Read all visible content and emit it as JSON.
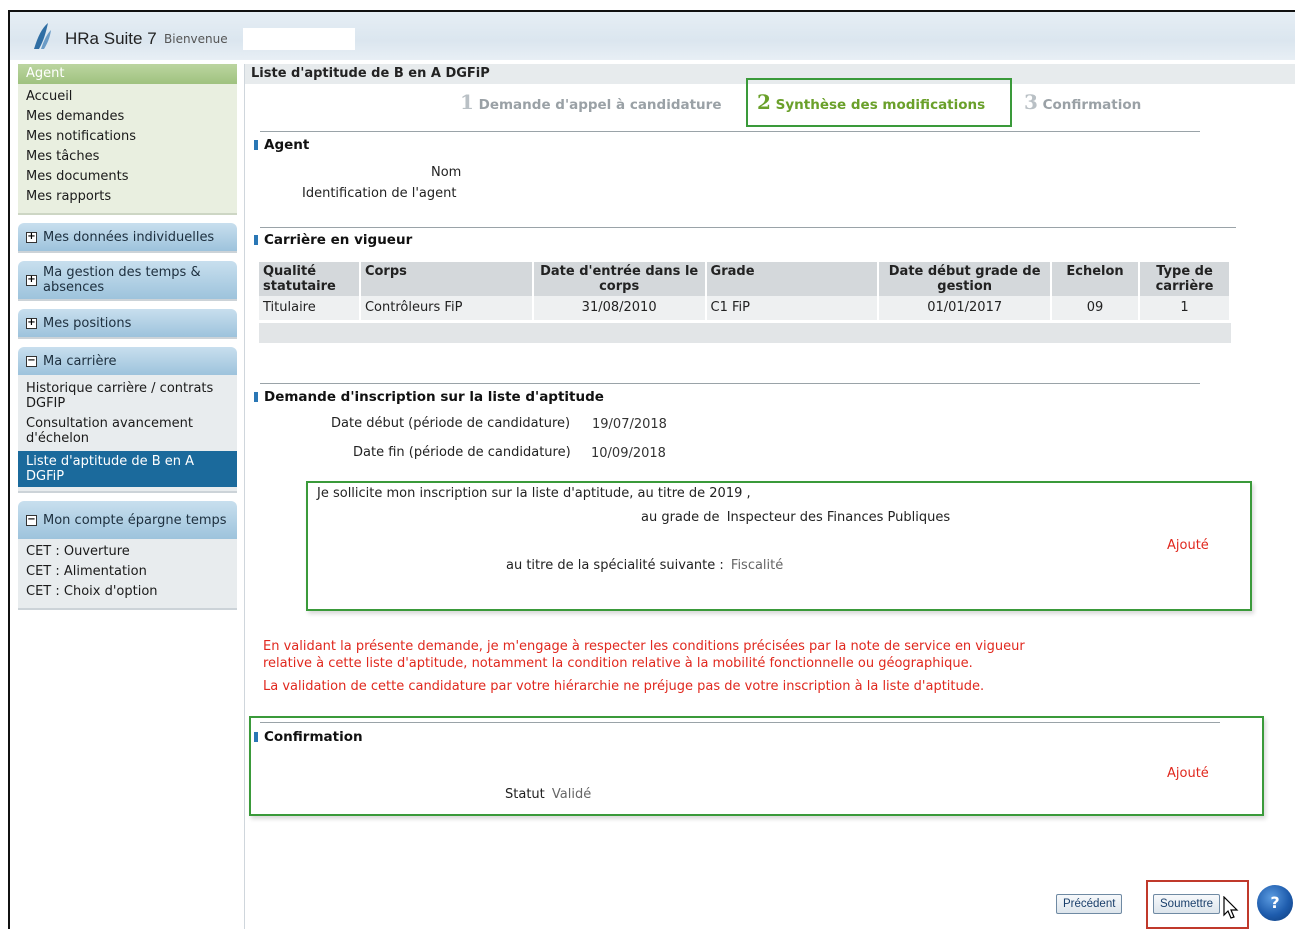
{
  "header": {
    "app_name": "HRa Suite 7",
    "welcome": "Bienvenue"
  },
  "sidebar": {
    "agent_panel": {
      "title": "Agent",
      "items": [
        "Accueil",
        "Mes demandes",
        "Mes notifications",
        "Mes tâches",
        "Mes documents",
        "Mes rapports"
      ]
    },
    "donnees": {
      "title": "Mes données individuelles",
      "toggle": "+"
    },
    "temps": {
      "title": "Ma gestion des temps & absences",
      "toggle": "+"
    },
    "positions": {
      "title": "Mes positions",
      "toggle": "+"
    },
    "carriere": {
      "title": "Ma carrière",
      "toggle": "−",
      "items": [
        "Historique carrière / contrats DGFIP",
        "Consultation avancement d'échelon",
        "Liste d'aptitude de B en A DGFiP"
      ],
      "active_index": 2
    },
    "cet": {
      "title": "Mon compte épargne temps",
      "toggle": "−",
      "items": [
        "CET : Ouverture",
        "CET : Alimentation",
        "CET : Choix d'option"
      ]
    }
  },
  "main": {
    "title": "Liste d'aptitude de B en A DGFiP",
    "steps": [
      {
        "num": "1",
        "label": "Demande d'appel à candidature"
      },
      {
        "num": "2",
        "label": "Synthèse des modifications"
      },
      {
        "num": "3",
        "label": "Confirmation"
      }
    ],
    "current_step": 2,
    "agent": {
      "title": "Agent",
      "nom_label": "Nom",
      "id_label": "Identification de l'agent"
    },
    "carriere": {
      "title": "Carrière en vigueur",
      "headers": [
        "Qualité statutaire",
        "Corps",
        "Date d'entrée dans le corps",
        "Grade",
        "Date début grade de gestion",
        "Echelon",
        "Type de carrière"
      ],
      "rows": [
        [
          "Titulaire",
          "Contrôleurs FiP",
          "31/08/2010",
          "C1 FiP",
          "01/01/2017",
          "09",
          "1"
        ]
      ]
    },
    "demande": {
      "title": "Demande d'inscription sur la liste d'aptitude",
      "date_debut_label": "Date début (période de candidature)",
      "date_debut": "19/07/2018",
      "date_fin_label": "Date fin (période de candidature)",
      "date_fin": "10/09/2018",
      "sollicite_text": "Je sollicite mon inscription sur la liste d'aptitude, au titre de",
      "annee": "2019",
      "annee_suffix": ",",
      "grade_label": "au grade de",
      "grade": "Inspecteur des Finances Publiques",
      "specialite_label": "au titre de la spécialité suivante :",
      "specialite": "Fiscalité",
      "status_tag": "Ajouté"
    },
    "warnings": [
      "En validant la présente demande, je m'engage à respecter les conditions précisées par la note de service en vigueur",
      "relative à cette liste d'aptitude, notamment la condition relative à la mobilité fonctionnelle ou géographique.",
      "La validation de cette candidature par votre hiérarchie ne préjuge pas de votre inscription à la liste d'aptitude."
    ],
    "confirmation": {
      "title": "Confirmation",
      "statut_label": "Statut",
      "statut": "Validé",
      "status_tag": "Ajouté"
    },
    "buttons": {
      "precedent": "Précédent",
      "soumettre": "Soumettre",
      "help": "?"
    }
  },
  "colors": {
    "accent_green": "#3a9a3a",
    "active_blue": "#1b6a9c",
    "warning_red": "#e0281e",
    "step_active": "#6aa02a"
  }
}
